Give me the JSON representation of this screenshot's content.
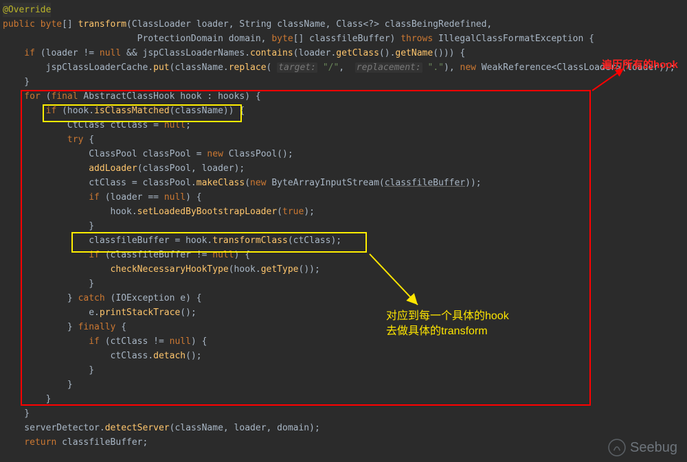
{
  "code": {
    "l1_anno": "@Override",
    "l2_a": "public",
    "l2_b": "byte",
    "l2_c": "[] ",
    "l2_method": "transform",
    "l2_d": "(ClassLoader loader, String className, Class<?> classBeingRedefined,",
    "l3_a": "                         ProtectionDomain domain, ",
    "l3_b": "byte",
    "l3_c": "[] classfileBuffer) ",
    "l3_throws": "throws",
    "l3_d": " IllegalClassFormatException {",
    "l4_a": "    if",
    "l4_b": " (loader != ",
    "l4_null": "null",
    "l4_c": " && jspClassLoaderNames.",
    "l4_m1": "contains",
    "l4_d": "(loader.",
    "l4_m2": "getClass",
    "l4_e": "().",
    "l4_m3": "getName",
    "l4_f": "())) {",
    "l5_a": "        jspClassLoaderCache.",
    "l5_m1": "put",
    "l5_b": "(className.",
    "l5_m2": "replace",
    "l5_c": "( ",
    "l5_h1": "target:",
    "l5_s1": "\"/\"",
    "l5_d": ",  ",
    "l5_h2": "replacement:",
    "l5_s2": "\".\"",
    "l5_e": "), ",
    "l5_new": "new",
    "l5_f": " WeakReference<ClassLoader>(loader));",
    "l6": "    }",
    "l7_a": "    for",
    "l7_b": " (",
    "l7_final": "final",
    "l7_c": " AbstractClassHook hook : hooks) {",
    "l8_a": "        if",
    "l8_b": " (hook.",
    "l8_m": "isClassMatched",
    "l8_c": "(className)) {",
    "l9_a": "            CtClass ctClass = ",
    "l9_null": "null",
    "l9_b": ";",
    "l10_a": "            try",
    "l10_b": " {",
    "l11_a": "                ClassPool classPool = ",
    "l11_new": "new",
    "l11_b": " ClassPool();",
    "l12_a": "                ",
    "l12_m": "addLoader",
    "l12_b": "(classPool, loader);",
    "l13_a": "                ctClass = classPool.",
    "l13_m": "makeClass",
    "l13_b": "(",
    "l13_new": "new",
    "l13_c": " ByteArrayInputStream(",
    "l13_u": "classfileBuffer",
    "l13_d": "));",
    "l14_a": "                if",
    "l14_b": " (loader == ",
    "l14_null": "null",
    "l14_c": ") {",
    "l15_a": "                    hook.",
    "l15_m": "setLoadedByBootstrapLoader",
    "l15_b": "(",
    "l15_true": "true",
    "l15_c": ");",
    "l16": "                }",
    "l17_a": "                classfileBuffer = hook.",
    "l17_m": "transformClass",
    "l17_b": "(ctClass);",
    "l18_a": "                if",
    "l18_b": " (classfileBuffer != ",
    "l18_null": "null",
    "l18_c": ") {",
    "l19_a": "                    ",
    "l19_m": "checkNecessaryHookType",
    "l19_b": "(hook.",
    "l19_m2": "getType",
    "l19_c": "());",
    "l20": "                }",
    "l21_a": "            } ",
    "l21_catch": "catch",
    "l21_b": " (IOException e) {",
    "l22_a": "                e.",
    "l22_m": "printStackTrace",
    "l22_b": "();",
    "l23_a": "            } ",
    "l23_fin": "finally",
    "l23_b": " {",
    "l24_a": "                if",
    "l24_b": " (ctClass != ",
    "l24_null": "null",
    "l24_c": ") {",
    "l25_a": "                    ctClass.",
    "l25_m": "detach",
    "l25_b": "();",
    "l26": "                }",
    "l27": "            }",
    "l28": "        }",
    "l29": "    }",
    "l30_a": "    serverDetector.",
    "l30_m": "detectServer",
    "l30_b": "(className, loader, domain);",
    "l31_a": "    return",
    "l31_b": " classfileBuffer;"
  },
  "annotations": {
    "red_label": "遍历所有的hook",
    "yellow_line1": "对应到每一个具体的hook",
    "yellow_line2": "去做具体的transform"
  },
  "watermark": "Seebug"
}
